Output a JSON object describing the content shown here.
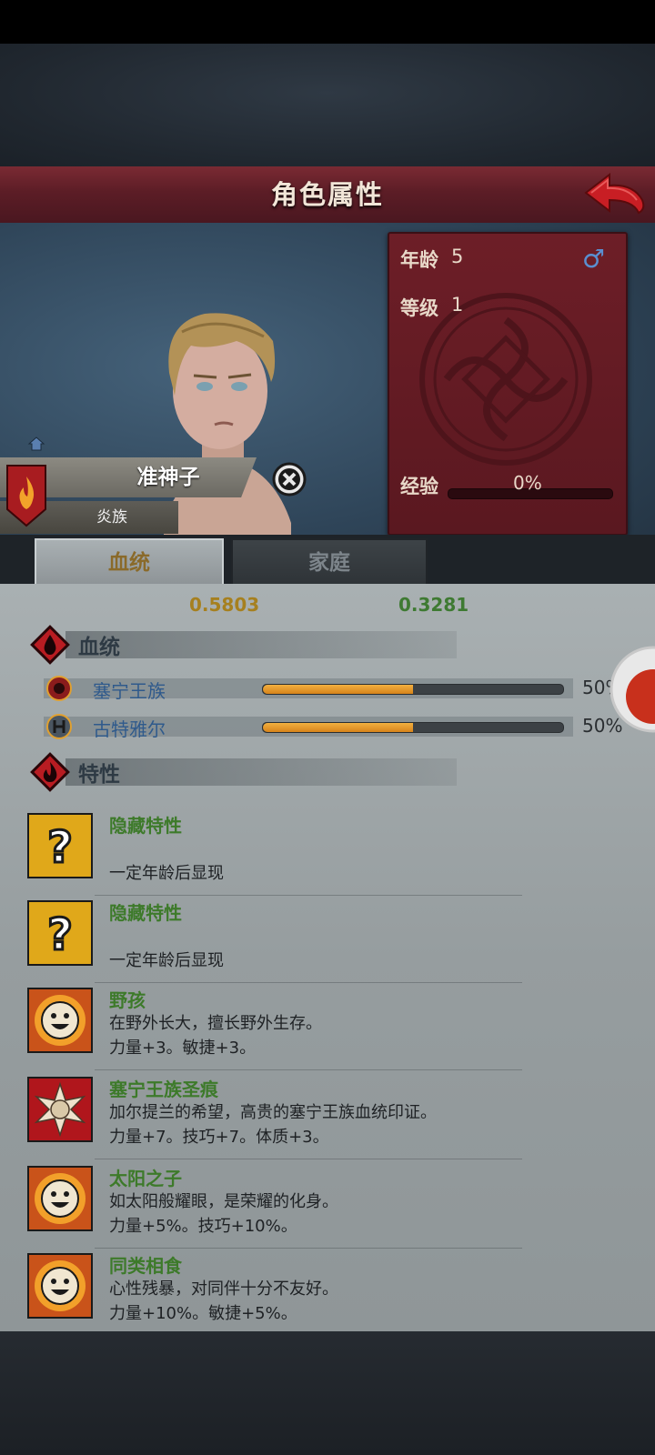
{
  "header": {
    "title": "角色属性"
  },
  "character": {
    "name": "准神子",
    "race": "炎族",
    "age_label": "年龄",
    "age_value": "5",
    "level_label": "等级",
    "level_value": "1",
    "exp_label": "经验",
    "exp_value": "0%",
    "gender_icon": "male-icon"
  },
  "tabs": [
    {
      "label": "血统",
      "active": true
    },
    {
      "label": "家庭",
      "active": false
    }
  ],
  "stats": {
    "left": "0.5803",
    "right": "0.3281"
  },
  "bloodline": {
    "title": "血统",
    "items": [
      {
        "name": "塞宁王族",
        "percent": "50%",
        "fill": 0.5
      },
      {
        "name": "古特雅尔",
        "percent": "50%",
        "fill": 0.5
      }
    ]
  },
  "traits": {
    "title": "特性",
    "items": [
      {
        "name": "隐藏特性",
        "line1": "",
        "line2": "一定年龄后显现",
        "icon": "question-icon"
      },
      {
        "name": "隐藏特性",
        "line1": "",
        "line2": "一定年龄后显现",
        "icon": "question-icon"
      },
      {
        "name": "野孩",
        "line1": "在野外长大，擅长野外生存。",
        "line2": "力量+3。敏捷+3。",
        "icon": "smiley-sun-icon"
      },
      {
        "name": "塞宁王族圣痕",
        "line1": "加尔提兰的希望，高贵的塞宁王族血统印证。",
        "line2": "力量+7。技巧+7。体质+3。",
        "icon": "sacred-mark-icon"
      },
      {
        "name": "太阳之子",
        "line1": "如太阳般耀眼，是荣耀的化身。",
        "line2": "力量+5%。技巧+10%。",
        "icon": "smiley-sun-icon"
      },
      {
        "name": "同类相食",
        "line1": "心性残暴，对同伴十分不友好。",
        "line2": "力量+10%。敏捷+5%。",
        "icon": "smiley-sun-icon"
      }
    ]
  },
  "colors": {
    "title_bar": "#5c1d26",
    "info_panel": "#6d1e27",
    "trait_name": "#3d7a2a",
    "blood_name": "#2f5a8c",
    "stat_left": "#a6801f",
    "stat_right": "#3e7a32"
  }
}
